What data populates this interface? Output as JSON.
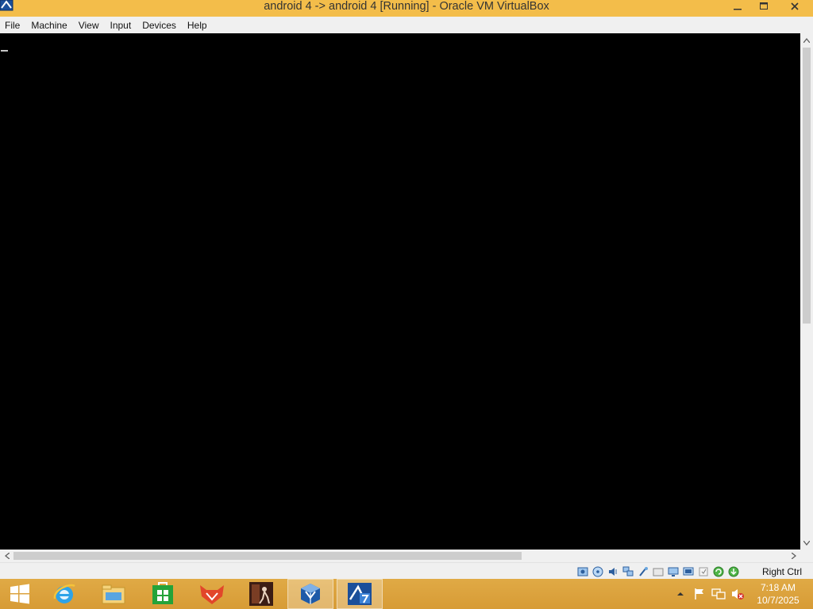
{
  "window": {
    "title": "android 4 -> android 4 [Running] - Oracle VM VirtualBox",
    "minimize_icon": "minimize-icon",
    "maximize_icon": "maximize-icon",
    "close_icon": "close-icon"
  },
  "menu": {
    "items": [
      {
        "label": "File"
      },
      {
        "label": "Machine"
      },
      {
        "label": "View"
      },
      {
        "label": "Input"
      },
      {
        "label": "Devices"
      },
      {
        "label": "Help"
      }
    ]
  },
  "statusbar": {
    "icons": [
      "hard-disk-icon",
      "optical-drive-icon",
      "audio-icon",
      "network-icon",
      "usb-icon",
      "shared-folders-icon",
      "display-icon",
      "video-capture-icon",
      "mouse-integration-icon",
      "cpu-activity-icon",
      "keyboard-capture-icon"
    ],
    "host_key": "Right Ctrl"
  },
  "taskbar": {
    "pinned": [
      "internet-explorer-icon",
      "file-explorer-icon",
      "store-icon",
      "fox-app-icon",
      "media-app-icon",
      "virtualbox-icon",
      "virtualbox-vm-icon"
    ],
    "tray_icons": [
      "action-center-flag-icon",
      "network-tray-icon",
      "volume-muted-icon"
    ]
  },
  "clock": {
    "time": "7:18 AM",
    "date": "10/7/2025"
  },
  "colors": {
    "titlebar": "#f3bd4a",
    "taskbar": "#d99e3a",
    "vm_screen": "#000000",
    "chrome": "#f0f0f0"
  }
}
